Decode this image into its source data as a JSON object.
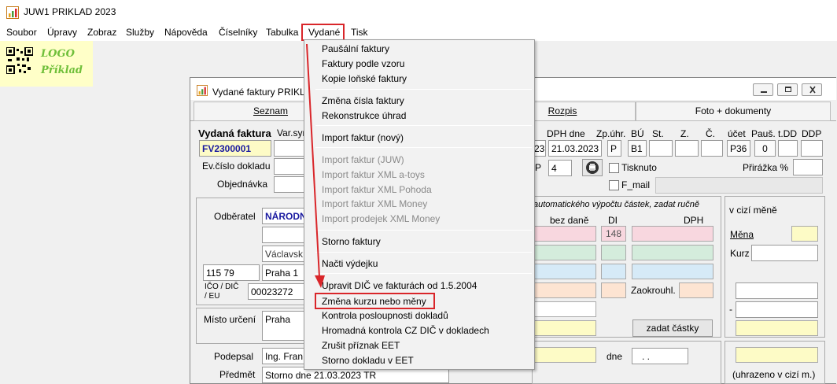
{
  "app": {
    "title": "JUW1 PRIKLAD 2023"
  },
  "menubar": {
    "items": [
      "Soubor",
      "Úpravy",
      "Zobraz",
      "Služby",
      "Nápověda",
      "Číselníky",
      "Tabulka",
      "Vydané",
      "Tisk"
    ],
    "active": "Vydané"
  },
  "logo": {
    "line1": "LOGO",
    "line2": "Příklad"
  },
  "child_window": {
    "title": "Vydané faktury PRIKLA"
  },
  "tabs": {
    "seznam": "Seznam",
    "rozpis": "Rozpis",
    "foto": "Foto + dokumenty"
  },
  "form": {
    "heading": "Vydaná faktura",
    "var_sym_label": "Var.sym",
    "invoice_number": "FV2300001",
    "ev_cislo_label": "Ev.číslo dokladu",
    "objednavka_label": "Objednávka",
    "odberatel_label": "Odběratel",
    "odberatel_value": "NÁRODN",
    "street_value": "Václavsk",
    "zip_value": "115 79",
    "city_value": "Praha 1",
    "ico_label_1": "IČO / DIČ",
    "ico_label_2": "/ EU",
    "ico_value": "00023272",
    "misto_label": "Místo určení",
    "misto_value": "Praha",
    "podepsal_label": "Podepsal",
    "podepsal_value": "Ing. Fran",
    "predmet_label": "Předmět",
    "predmet_value": "Storno dne 21.03.2023 TR",
    "col_headers": [
      "DPH dne",
      "Zp.úhr.",
      "BÚ",
      "St.",
      "Z.",
      "Č.",
      "účet",
      "Pauš.",
      "t.DD",
      "DDP"
    ],
    "date_partial": "23",
    "dph_dne_value": "21.03.2023",
    "zp_uhr_value": "P",
    "bu_value": "B1",
    "ucet_value": "P36",
    "paus_value": "0",
    "pp_label": "P",
    "pp_value": "4",
    "tisknuto_label": "Tisknuto",
    "fmail_label": "F_mail",
    "prirazka_label": "Přirážka %",
    "auto_calc_text": "automatického výpočtu částek, zadat ručně",
    "bez_dane_label": "bez daně",
    "di_label": "DI",
    "dph_label": "DPH",
    "di_value": "148",
    "zaokrouhl_label": "Zaokrouhl.",
    "zadat_castky_button": "zadat částky",
    "dne_label": "dne",
    "dne_value": ". .",
    "v_cizi_mene_label": "v cizí měně",
    "mena_label": "Měna",
    "kurz_label": "Kurz",
    "dash": "-",
    "uhrazeno_label": "(uhrazeno v cizí m.)"
  },
  "dropdown": {
    "items": [
      {
        "label": "Paušální faktury",
        "enabled": true
      },
      {
        "label": "Faktury podle vzoru",
        "enabled": true
      },
      {
        "label": "Kopie loňské faktury",
        "enabled": true
      },
      {
        "label": "Změna čísla faktury",
        "enabled": true
      },
      {
        "label": "Rekonstrukce úhrad",
        "enabled": true
      },
      {
        "label": "Import faktur (nový)",
        "enabled": true
      },
      {
        "label": "Import faktur (JUW)",
        "enabled": false
      },
      {
        "label": "Import faktur XML a-toys",
        "enabled": false
      },
      {
        "label": "Import faktur XML Pohoda",
        "enabled": false
      },
      {
        "label": "Import faktur XML Money",
        "enabled": false
      },
      {
        "label": "Import prodejek XML Money",
        "enabled": false
      },
      {
        "label": "Storno faktury",
        "enabled": true
      },
      {
        "label": "Načti výdejku",
        "enabled": true
      },
      {
        "label": "Upravit DIČ ve fakturách od 1.5.2004",
        "enabled": true
      },
      {
        "label": "Změna kurzu nebo měny",
        "enabled": true
      },
      {
        "label": "Kontrola posloupnosti dokladů",
        "enabled": true
      },
      {
        "label": "Hromadná kontrola CZ DIČ v dokladech",
        "enabled": true
      },
      {
        "label": "Zrušit příznak EET",
        "enabled": true
      },
      {
        "label": "Storno dokladu v EET",
        "enabled": true
      }
    ],
    "highlighted": "Změna kurzu nebo měny"
  },
  "colors": {
    "annotation": "#d9262a",
    "invoice_number": "#1a1aa0",
    "logo_text": "#6fbf3a",
    "logo_bg": "#ffffc8"
  }
}
